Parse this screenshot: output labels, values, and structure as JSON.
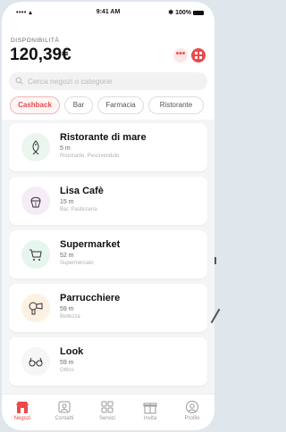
{
  "status_bar": {
    "signal": "•••• ▴",
    "time": "9:41 AM",
    "battery": "✱ 100%"
  },
  "header": {
    "label": "DISPONIBILITÀ",
    "balance": "120,39€",
    "more_label": "•••"
  },
  "search": {
    "placeholder": "Cerca negozi o categorie"
  },
  "chips": [
    "Cashback",
    "Bar",
    "Farmacia",
    "Ristorante"
  ],
  "shops": [
    {
      "name": "Ristorante di mare",
      "distance": "5 m",
      "category": "Ristorante, Pescivendolo",
      "icon": "fish-icon",
      "color": "#eaf6ee"
    },
    {
      "name": "Lisa Cafè",
      "distance": "15 m",
      "category": "Bar, Pasticceria",
      "icon": "cupcake-icon",
      "color": "#f6ecf7"
    },
    {
      "name": "Supermarket",
      "distance": "52 m",
      "category": "Supermercato",
      "icon": "cart-icon",
      "color": "#e6f5ee"
    },
    {
      "name": "Parrucchiere",
      "distance": "59 m",
      "category": "Bellezza",
      "icon": "hairdryer-icon",
      "color": "#fdf1e3"
    },
    {
      "name": "Look",
      "distance": "59 m",
      "category": "Ottico",
      "icon": "glasses-icon",
      "color": "#f6f6f6"
    }
  ],
  "tabs": [
    {
      "label": "Negozi",
      "icon": "store-icon",
      "active": true
    },
    {
      "label": "Contatti",
      "icon": "contacts-icon",
      "active": false
    },
    {
      "label": "Servizi",
      "icon": "services-icon",
      "active": false
    },
    {
      "label": "Invita",
      "icon": "gift-icon",
      "active": false
    },
    {
      "label": "Profilo",
      "icon": "profile-icon",
      "active": false
    }
  ],
  "colors": {
    "accent": "#e84a4a",
    "background": "#f4f5f7"
  }
}
